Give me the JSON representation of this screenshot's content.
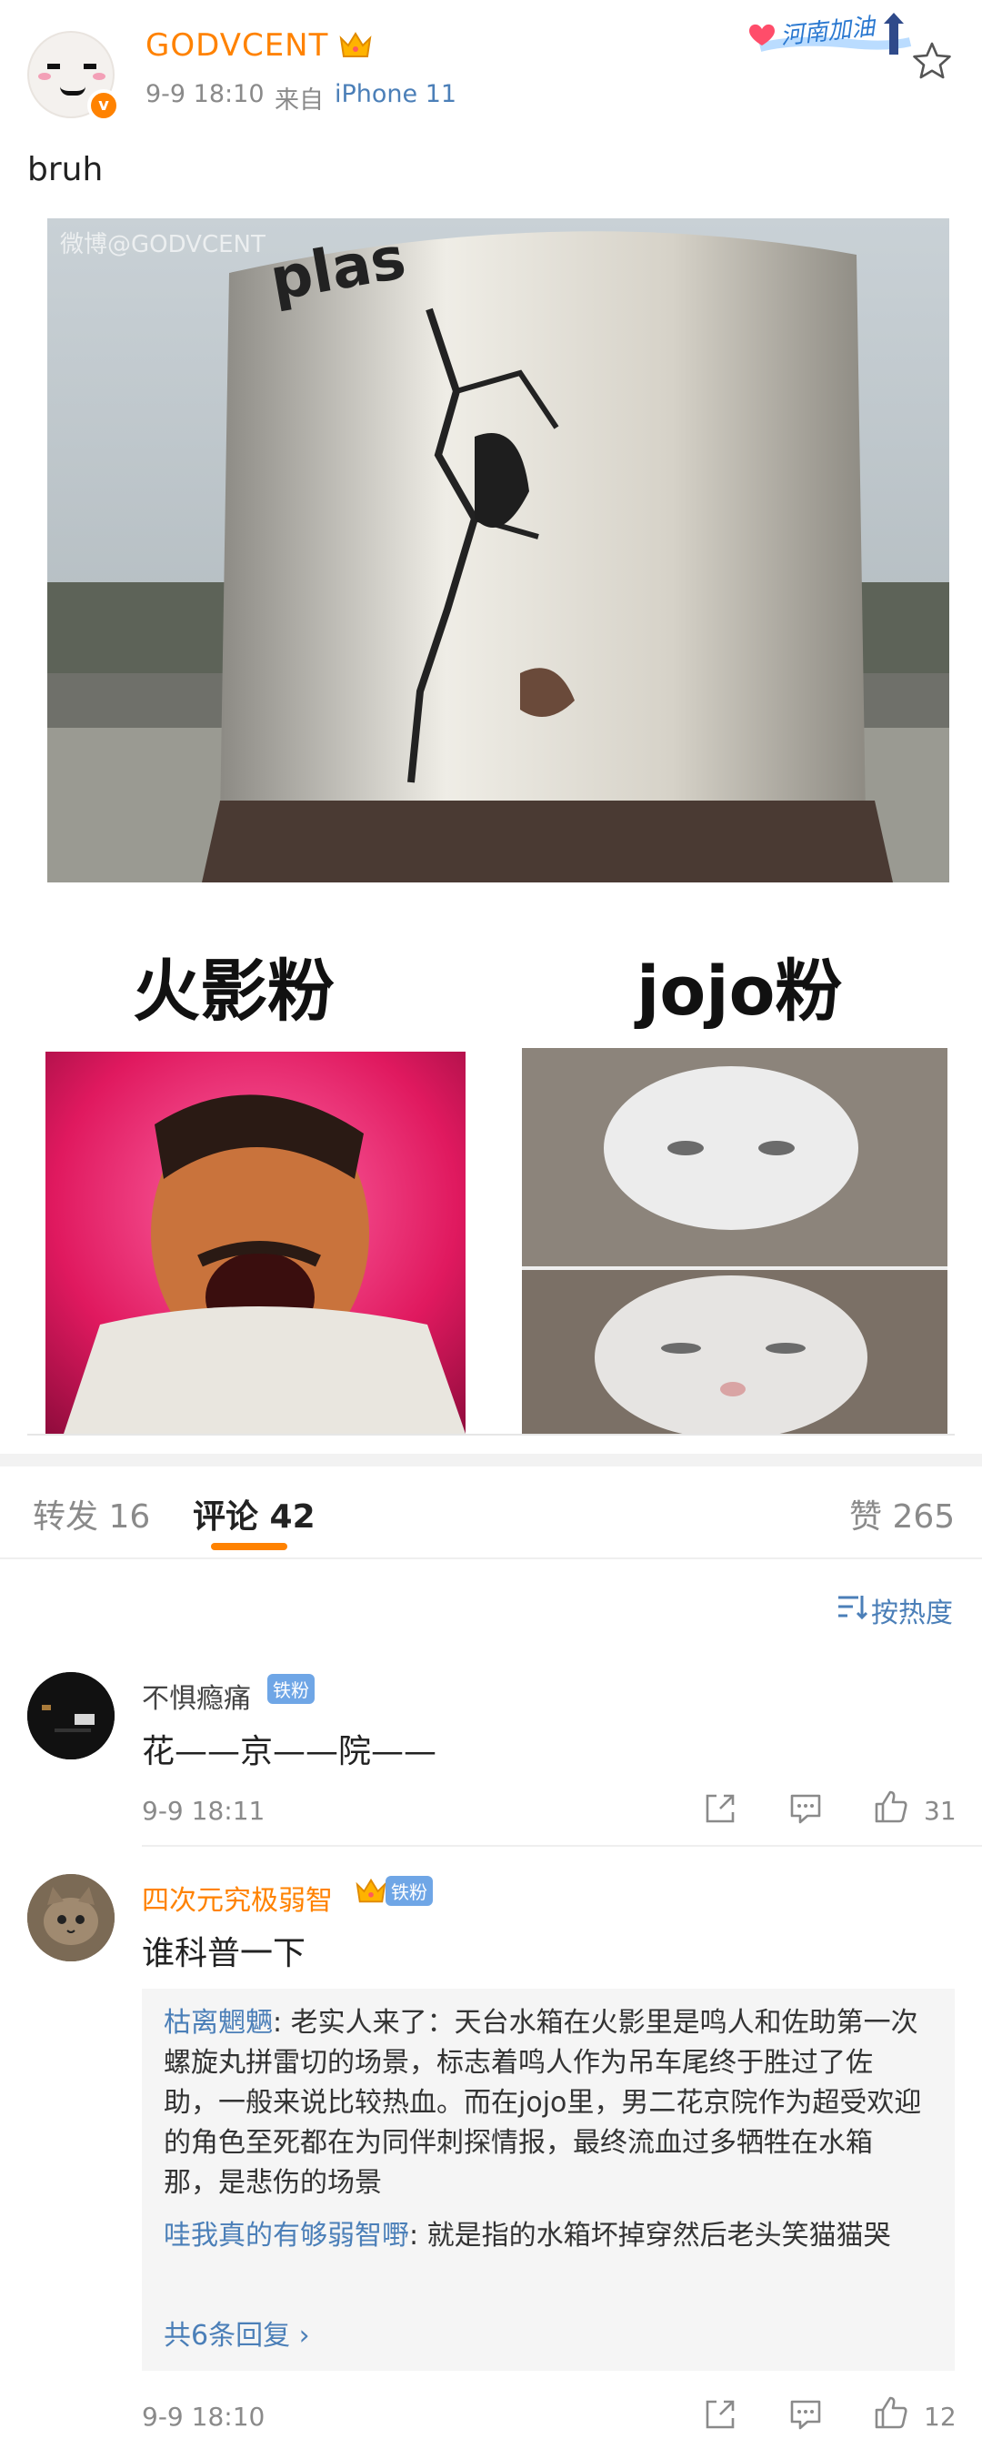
{
  "post": {
    "username": "GODVCENT",
    "time": "9-9 18:10",
    "source_label": "来自",
    "source": "iPhone 11",
    "campaign_badge": "河南加油",
    "text": "bruh",
    "image": {
      "watermark": "微博@GODVCENT",
      "label_left": "火影粉",
      "label_right": "jojo粉"
    },
    "icons": {
      "avatar": "pixel-face-avatar",
      "verify": "verified-v-icon",
      "crown": "crown-icon",
      "favorite": "star-icon"
    }
  },
  "tabs": {
    "repost": "转发 16",
    "comments": "评论 42",
    "likes": "赞 265"
  },
  "sort": {
    "label": "按热度"
  },
  "comments": [
    {
      "name": "不惧瘾痛",
      "badge": "铁粉",
      "text": "花——京——院——",
      "time": "9-9 18:11",
      "likes": "31"
    },
    {
      "name": "四次元究极弱智",
      "badge": "铁粉",
      "text": "谁科普一下",
      "time": "9-9 18:10",
      "likes": "12",
      "replies": [
        {
          "user": "枯离魍魉",
          "text": ": 老实人来了：天台水箱在火影里是鸣人和佐助第一次螺旋丸拼雷切的场景，标志着鸣人作为吊车尾终于胜过了佐助，一般来说比较热血。而在jojo里，男二花京院作为超受欢迎的角色至死都在为同伴刺探情报，最终流血过多牺牲在水箱那，是悲伤的场景"
        },
        {
          "user": "哇我真的有够弱智嘢",
          "text": ": 就是指的水箱坏掉穿然后老头笑猫猫哭"
        }
      ],
      "more_replies": "共6条回复 ›"
    }
  ],
  "colors": {
    "accent": "#ff8200",
    "link": "#4b7fb8",
    "muted": "#8a8a8a"
  }
}
